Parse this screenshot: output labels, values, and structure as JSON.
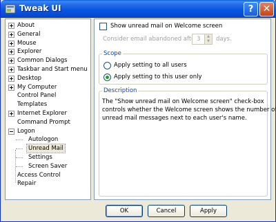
{
  "window": {
    "title": "Tweak UI",
    "help_symbol": "?",
    "close_symbol": "✕"
  },
  "tree": {
    "items": [
      {
        "label": "About",
        "expander": "plus"
      },
      {
        "label": "General",
        "expander": "plus"
      },
      {
        "label": "Mouse",
        "expander": "plus"
      },
      {
        "label": "Explorer",
        "expander": "plus"
      },
      {
        "label": "Common Dialogs",
        "expander": "plus"
      },
      {
        "label": "Taskbar and Start menu",
        "expander": "plus"
      },
      {
        "label": "Desktop",
        "expander": "plus"
      },
      {
        "label": "My Computer",
        "expander": "plus"
      },
      {
        "label": "Control Panel",
        "expander": "none"
      },
      {
        "label": "Templates",
        "expander": "none"
      },
      {
        "label": "Internet Explorer",
        "expander": "plus"
      },
      {
        "label": "Command Prompt",
        "expander": "none"
      },
      {
        "label": "Logon",
        "expander": "minus"
      },
      {
        "label": "Autologon",
        "expander": "child"
      },
      {
        "label": "Unread Mail",
        "expander": "child",
        "selected": true
      },
      {
        "label": "Settings",
        "expander": "child"
      },
      {
        "label": "Screen Saver",
        "expander": "child"
      },
      {
        "label": "Access Control",
        "expander": "none"
      },
      {
        "label": "Repair",
        "expander": "none"
      }
    ]
  },
  "settings": {
    "show_unread_label": "Show unread mail on Welcome screen",
    "show_unread_checked": false,
    "abandon_prefix": "Consider email abandoned after",
    "abandon_value": "3",
    "abandon_suffix": "days."
  },
  "scope": {
    "title": "Scope",
    "all_users_label": "Apply setting to all users",
    "this_user_label": "Apply setting to this user only",
    "selected": "this_user"
  },
  "description": {
    "title": "Description",
    "lines": [
      "The \"Show unread mail on Welcome screen\" check-box",
      "controls whether the Welcome screen shows the number of",
      "unread mail messages next to each user's name."
    ]
  },
  "buttons": {
    "ok": "OK",
    "cancel": "Cancel",
    "apply": "Apply"
  },
  "colors": {
    "titlebar": "#0a55e0",
    "group_title": "#0046d5",
    "radio_dot": "#21a121"
  }
}
